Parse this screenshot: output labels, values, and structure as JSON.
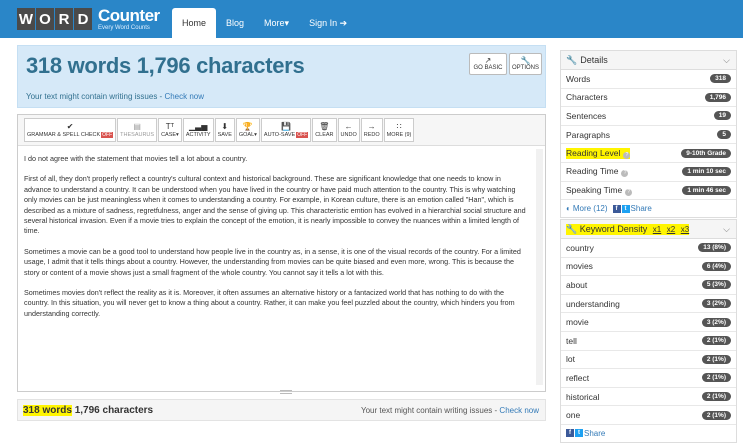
{
  "navbar": {
    "logo_letters": [
      "W",
      "O",
      "R",
      "D"
    ],
    "logo_word": "Counter",
    "logo_tagline": "Every Word Counts",
    "items": [
      {
        "label": "Home"
      },
      {
        "label": "Blog"
      },
      {
        "label": "More▾"
      },
      {
        "label": "Sign In ➔"
      }
    ]
  },
  "heading": {
    "title": "318 words 1,796 characters",
    "issue_text": "Your text might contain writing issues - ",
    "issue_link": "Check now",
    "go_basic": "GO BASIC",
    "options": "OPTIONS"
  },
  "toolbar": {
    "grammar": "GRAMMAR & SPELL CHECK",
    "off": "OFF",
    "thesaurus": "THESAURUS",
    "case": "CASE▾",
    "activity": "ACTIVITY",
    "save": "SAVE",
    "goal": "GOAL▾",
    "autosave": "AUTO-SAVE",
    "clear": "CLEAR",
    "undo": "UNDO",
    "redo": "REDO",
    "more": "MORE (9)"
  },
  "text": {
    "p1": "I do not agree with the statement that movies tell a lot about a country.",
    "p2": "First of all, they don't properly reflect a country's cultural context and historical background. These are significant knowledge that one needs to know in advance to understand a country. It can be understood when you have lived in the country or have paid much attention to the country. This is why watching only movies can be just meaningless when it comes to understanding a country. For example, in Korean culture, there is an emotion called \"Han\", which is described as a mixture of sadness, regretfulness, anger and the sense of giving up. This characteristic emtion has evolved in a hierarchial social structure and several historical invasion. Even if a movie tries to explain the concept of the emotion, it is nearly impossible to convey the nuances within a limited length of time.",
    "p3": "Sometimes a movie can be a good tool to understand how people live in the country as, in a sense, it is one of the visual records of the country. For a limited usage, I admit that it tells things about a country. However, the understanding from movies can be quite biased and even more, wrong. This is because the story or content of a movie shows just a small fragment of the whole country. You cannot say it tells a lot with this.",
    "p4": "Sometimes movies don't reflect the reality as it is. Moreover, it often assumes an alternative history or a fantacized world that has nothing to do with the country. In this situation, you will never get to know a thing about a country. Rather, it can make you feel puzzled about the country, which hinders you from understanding correctly."
  },
  "footer": {
    "words": "318 words",
    "chars": "1,796 characters",
    "issue_text": "Your text might contain writing issues - ",
    "issue_link": "Check now"
  },
  "details": {
    "title": "Details",
    "rows": [
      {
        "label": "Words",
        "value": "318"
      },
      {
        "label": "Characters",
        "value": "1,796"
      },
      {
        "label": "Sentences",
        "value": "19"
      },
      {
        "label": "Paragraphs",
        "value": "5"
      },
      {
        "label": "Reading Level",
        "value": "9-10th Grade"
      },
      {
        "label": "Reading Time",
        "value": "1 min 10 sec"
      },
      {
        "label": "Speaking Time",
        "value": "1 min 46 sec"
      }
    ],
    "more": "More (12)",
    "share": "Share"
  },
  "keywords": {
    "title": "Keyword Density",
    "x1": "x1",
    "x2": "x2",
    "x3": "x3",
    "rows": [
      {
        "label": "country",
        "value": "13 (8%)"
      },
      {
        "label": "movies",
        "value": "6 (4%)"
      },
      {
        "label": "about",
        "value": "5 (3%)"
      },
      {
        "label": "understanding",
        "value": "3 (2%)"
      },
      {
        "label": "movie",
        "value": "3 (2%)"
      },
      {
        "label": "tell",
        "value": "2 (1%)"
      },
      {
        "label": "lot",
        "value": "2 (1%)"
      },
      {
        "label": "reflect",
        "value": "2 (1%)"
      },
      {
        "label": "historical",
        "value": "2 (1%)"
      },
      {
        "label": "one",
        "value": "2 (1%)"
      }
    ],
    "share": "Share"
  },
  "colors": {
    "nav": "#2a86c8",
    "highlight": "#fff500",
    "badge": "#555555",
    "off": "#d9534f"
  }
}
